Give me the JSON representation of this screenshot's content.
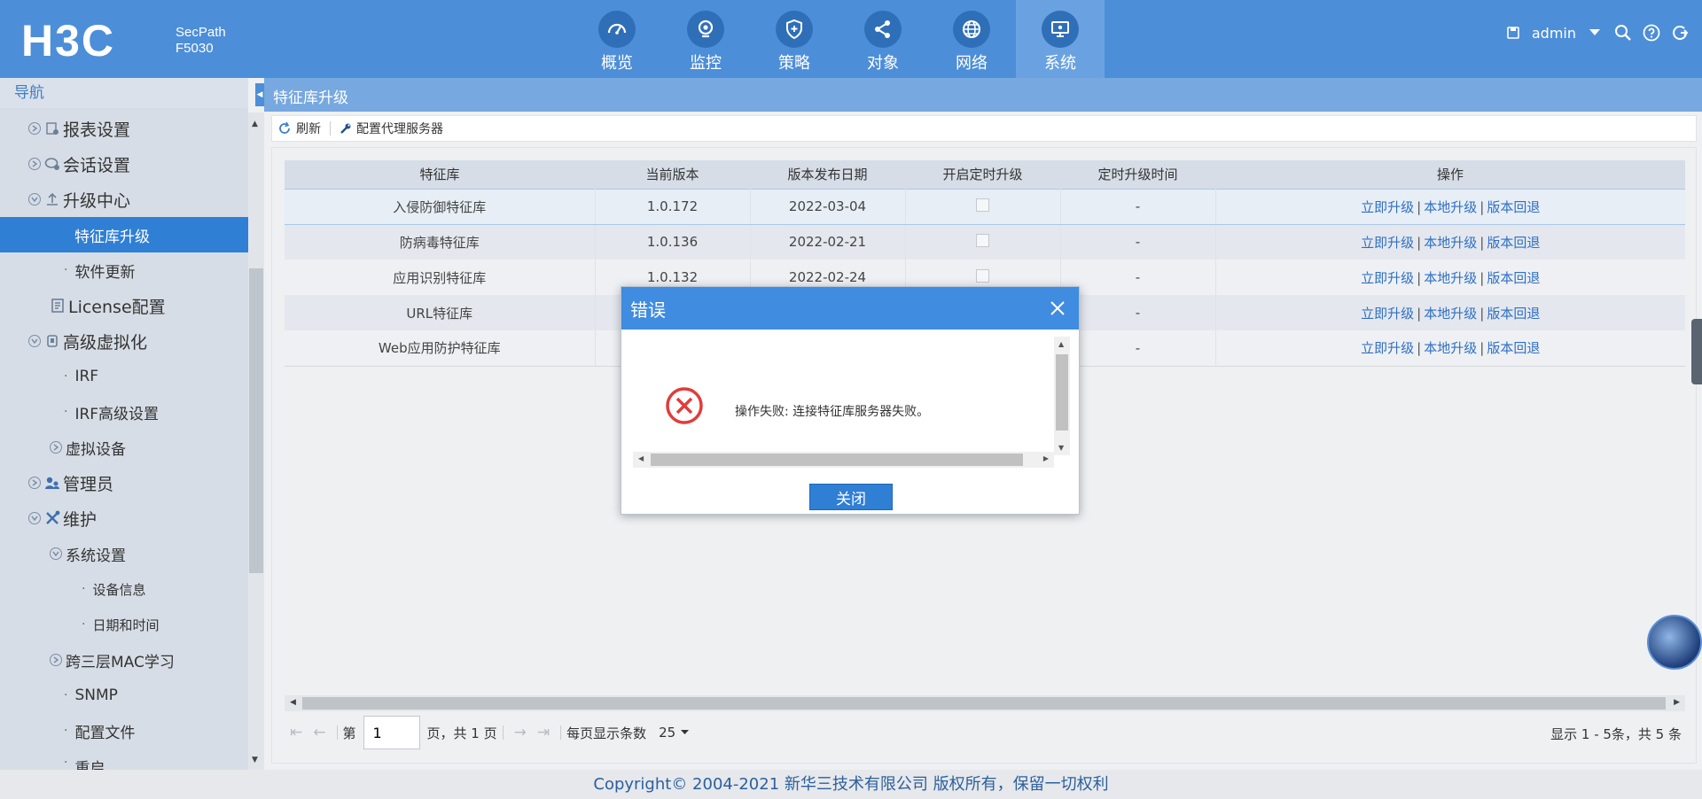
{
  "header": {
    "logo": "H3C",
    "product_line1": "SecPath",
    "product_line2": "F5030",
    "nav": [
      {
        "label": "概览",
        "icon": "gauge-icon"
      },
      {
        "label": "监控",
        "icon": "camera-icon"
      },
      {
        "label": "策略",
        "icon": "shield-icon"
      },
      {
        "label": "对象",
        "icon": "share-icon"
      },
      {
        "label": "网络",
        "icon": "globe-icon"
      },
      {
        "label": "系统",
        "icon": "monitor-icon",
        "active": true
      }
    ],
    "user": "admin"
  },
  "sidebar": {
    "title": "导航",
    "items": [
      {
        "label": "报表设置"
      },
      {
        "label": "会话设置"
      },
      {
        "label": "升级中心"
      },
      {
        "label": "特征库升级"
      },
      {
        "label": "软件更新"
      },
      {
        "label": "License配置"
      },
      {
        "label": "高级虚拟化"
      },
      {
        "label": "IRF"
      },
      {
        "label": "IRF高级设置"
      },
      {
        "label": "虚拟设备"
      },
      {
        "label": "管理员"
      },
      {
        "label": "维护"
      },
      {
        "label": "系统设置"
      },
      {
        "label": "设备信息"
      },
      {
        "label": "日期和时间"
      },
      {
        "label": "跨三层MAC学习"
      },
      {
        "label": "SNMP"
      },
      {
        "label": "配置文件"
      },
      {
        "label": "重启"
      }
    ]
  },
  "main": {
    "title": "特征库升级",
    "toolbar": {
      "refresh": "刷新",
      "proxy": "配置代理服务器"
    },
    "table": {
      "headers": [
        "特征库",
        "当前版本",
        "版本发布日期",
        "开启定时升级",
        "定时升级时间",
        "操作"
      ],
      "rows": [
        {
          "name": "入侵防御特征库",
          "version": "1.0.172",
          "date": "2022-03-04",
          "time": "-"
        },
        {
          "name": "防病毒特征库",
          "version": "1.0.136",
          "date": "2022-02-21",
          "time": "-"
        },
        {
          "name": "应用识别特征库",
          "version": "1.0.132",
          "date": "2022-02-24",
          "time": "-"
        },
        {
          "name": "URL特征库",
          "version": "",
          "date": "",
          "time": "-"
        },
        {
          "name": "Web应用防护特征库",
          "version": "",
          "date": "",
          "time": "-"
        }
      ],
      "actions": {
        "upgrade": "立即升级",
        "local": "本地升级",
        "rollback": "版本回退",
        "sep": "|"
      }
    },
    "pager": {
      "page_prefix": "第",
      "page_value": "1",
      "page_suffix": "页，共 1 页",
      "per_page_label": "每页显示条数",
      "per_page_value": "25",
      "summary": "显示 1 - 5条，共 5 条"
    }
  },
  "dialog": {
    "title": "错误",
    "message": "操作失败: 连接特征库服务器失败。",
    "close_button": "关闭"
  },
  "footer": {
    "copyright": "Copyright© 2004-2021 新华三技术有限公司 版权所有，保留一切权利"
  }
}
